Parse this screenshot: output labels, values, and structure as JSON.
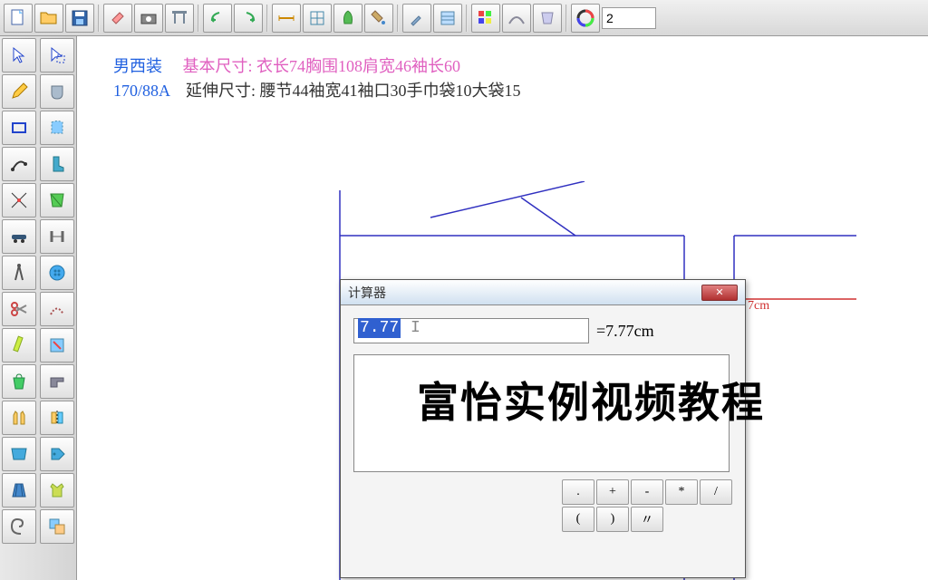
{
  "toolbar_number": "2",
  "info": {
    "label1": "男西装",
    "label2": "170/88A",
    "basic_label": "基本尺寸:",
    "basic_values": "衣长74胸围108肩宽46袖长60",
    "ext_label": "延伸尺寸:",
    "ext_values": "腰节44袖宽41袖口30手巾袋10大袋15"
  },
  "calculator": {
    "title": "计算器",
    "input_value": "7.77",
    "result_text": "=7.77cm",
    "keys_row1": [
      ".",
      "+",
      "-",
      "*",
      "/"
    ],
    "keys_row2": [
      "(",
      ")",
      "〃",
      "",
      ""
    ]
  },
  "red_annotation": "7cm",
  "watermark": "富怡实例视频教程",
  "top_icons": [
    "new",
    "open",
    "save",
    "",
    "eraser",
    "camera",
    "print",
    "",
    "undo",
    "redo",
    "",
    "measure",
    "grid",
    "shape",
    "color",
    "",
    "brush",
    "texture",
    "",
    "palette",
    "curve",
    "tool",
    "",
    "colorwheel"
  ],
  "left_col1": [
    "pointer",
    "pencil",
    "rect",
    "curve",
    "anchor",
    "car",
    "compass",
    "scissors",
    "pen2",
    "bag",
    "vest",
    "fabric",
    "skirt",
    "spiral"
  ],
  "left_col2": [
    "select",
    "pocket",
    "piece",
    "boot",
    "pattern",
    "ruler",
    "button",
    "seam",
    "tool3",
    "machine",
    "flip",
    "tag",
    "vest2",
    "clone"
  ]
}
